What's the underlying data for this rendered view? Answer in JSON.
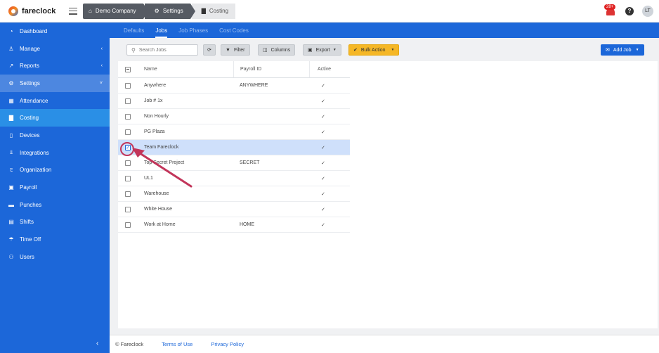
{
  "app": {
    "logo": "fareclock"
  },
  "breadcrumb": [
    {
      "label": "Demo Company",
      "icon": "home-icon"
    },
    {
      "label": "Settings",
      "icon": "gear-icon"
    },
    {
      "label": "Costing",
      "icon": "costing-icon"
    }
  ],
  "header": {
    "notification_count": "28+",
    "help": "?",
    "user_initials": "LT"
  },
  "sidebar": {
    "items": [
      {
        "label": "Dashboard",
        "icon": "dashboard-icon",
        "glyph": "◔"
      },
      {
        "label": "Manage",
        "icon": "person-icon",
        "glyph": "♙",
        "chevron": "‹"
      },
      {
        "label": "Reports",
        "icon": "chart-icon",
        "glyph": "↗",
        "chevron": "‹"
      },
      {
        "label": "Settings",
        "icon": "gear-icon",
        "glyph": "⚙",
        "chevron": "˅"
      },
      {
        "label": "Attendance",
        "icon": "calendar-icon",
        "glyph": "▦"
      },
      {
        "label": "Costing",
        "icon": "costing-icon",
        "glyph": "▇"
      },
      {
        "label": "Devices",
        "icon": "device-icon",
        "glyph": "▯"
      },
      {
        "label": "Integrations",
        "icon": "plug-icon",
        "glyph": "⫫"
      },
      {
        "label": "Organization",
        "icon": "org-icon",
        "glyph": "⩳"
      },
      {
        "label": "Payroll",
        "icon": "money-icon",
        "glyph": "▣"
      },
      {
        "label": "Punches",
        "icon": "punch-icon",
        "glyph": "▬"
      },
      {
        "label": "Shifts",
        "icon": "briefcase-icon",
        "glyph": "▤"
      },
      {
        "label": "Time Off",
        "icon": "umbrella-icon",
        "glyph": "☂"
      },
      {
        "label": "Users",
        "icon": "users-icon",
        "glyph": "⚇"
      }
    ],
    "collapse": "‹"
  },
  "tabs": [
    {
      "label": "Defaults"
    },
    {
      "label": "Jobs"
    },
    {
      "label": "Job Phases"
    },
    {
      "label": "Cost Codes"
    }
  ],
  "toolbar": {
    "search_placeholder": "Search Jobs",
    "filter_label": "Filter",
    "columns_label": "Columns",
    "export_label": "Export",
    "bulk_label": "Bulk Action",
    "add_label": "Add Job"
  },
  "table": {
    "columns": [
      "Name",
      "Payroll ID",
      "Active"
    ],
    "rows": [
      {
        "name": "Anywhere",
        "payroll_id": "ANYWHERE",
        "active": "✓"
      },
      {
        "name": "Job # 1x",
        "payroll_id": "",
        "active": "✓"
      },
      {
        "name": "Non Hourly",
        "payroll_id": "",
        "active": "✓"
      },
      {
        "name": "PG Plaza",
        "payroll_id": "",
        "active": "✓"
      },
      {
        "name": "Team Fareclock",
        "payroll_id": "",
        "active": "✓"
      },
      {
        "name": "Top Secret Project",
        "payroll_id": "SECRET",
        "active": "✓"
      },
      {
        "name": "UL1",
        "payroll_id": "",
        "active": "✓"
      },
      {
        "name": "Warehouse",
        "payroll_id": "",
        "active": "✓"
      },
      {
        "name": "White House",
        "payroll_id": "",
        "active": "✓"
      },
      {
        "name": "Work at Home",
        "payroll_id": "HOME",
        "active": "✓"
      }
    ]
  },
  "footer": {
    "copyright": "© Fareclock",
    "terms": "Terms of Use",
    "privacy": "Privacy Policy"
  },
  "colors": {
    "primary": "#1c67d9",
    "bulk": "#f5b726",
    "selected_row": "#cfe0fb",
    "annotation": "#c2355a"
  }
}
